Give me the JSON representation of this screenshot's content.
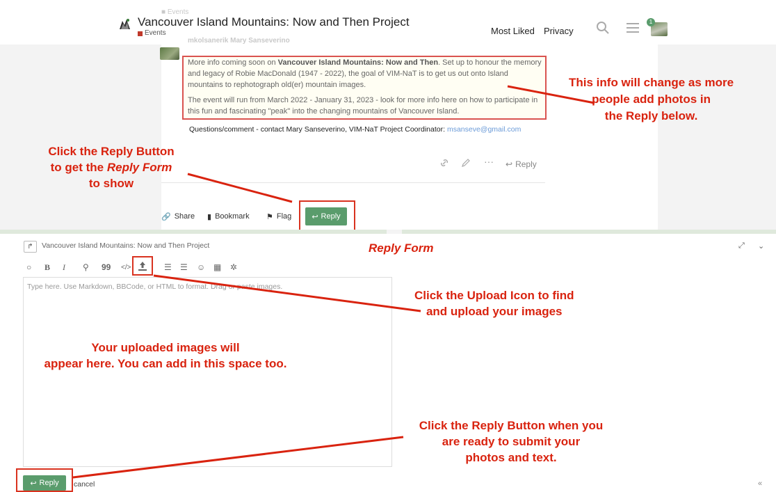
{
  "header": {
    "topic_title": "Vancouver Island Mountains: Now and Then Project",
    "category": "Events",
    "nav_most_liked": "Most Liked",
    "nav_privacy": "Privacy",
    "notification_count": "1"
  },
  "post": {
    "faint_top": "■ Events",
    "faint_author": "mkolsanerik Mary Sanseverino",
    "paragraph1_prefix": "More info coming soon on ",
    "paragraph1_bold": "Vancouver Island Mountains: Now and Then",
    "paragraph1_suffix": ". Set up to honour the memory and legacy of Robie MacDonald (1947 - 2022), the goal of VIM-NaT is to get us out onto Island mountains to rephotograph old(er) mountain images.",
    "paragraph2": "The event will run from March 2022 - January 31, 2023 - look for more info here on how to participate in this fun and fascinating \"peak\" into the changing mountains of Vancouver Island.",
    "questions_text": "Questions/comment - contact Mary Sanseverino, VIM-NaT Project Coordinator: ",
    "questions_email": "msanseve@gmail.com",
    "reply_action": "Reply"
  },
  "topic_footer": {
    "share": "Share",
    "bookmark": "Bookmark",
    "flag": "Flag",
    "reply": "Reply"
  },
  "composer": {
    "reply_to_title": "Vancouver Island Mountains: Now and Then Project",
    "placeholder": "Type here. Use Markdown, BBCode, or HTML to format. Drag or paste images.",
    "reply_button": "Reply",
    "cancel": "cancel",
    "collapse": "«",
    "toolbar": [
      "quote-icon",
      "bold-icon",
      "italic-icon",
      "link-icon",
      "blockquote-icon",
      "code-icon",
      "upload-icon",
      "bullet-list-icon",
      "numbered-list-icon",
      "emoji-icon",
      "date-icon",
      "gear-icon"
    ]
  },
  "annotations": {
    "info_change": [
      "This info will change as more",
      "people add photos in",
      "the Reply below."
    ],
    "click_reply": [
      "Click the Reply Button",
      "to get the ",
      "Reply Form",
      "to show"
    ],
    "reply_form": "Reply Form",
    "upload_icon": [
      "Click the Upload Icon to find",
      "and upload your images"
    ],
    "uploaded_images": [
      "Your uploaded images will",
      "appear here. You can add in this space too."
    ],
    "reply_submit": [
      "Click the Reply Button when you",
      "are ready to submit your",
      "photos and text."
    ]
  },
  "colors": {
    "annotation_red": "#d9230f",
    "reply_green": "#5a9c6c",
    "category_red": "#c0392b"
  }
}
